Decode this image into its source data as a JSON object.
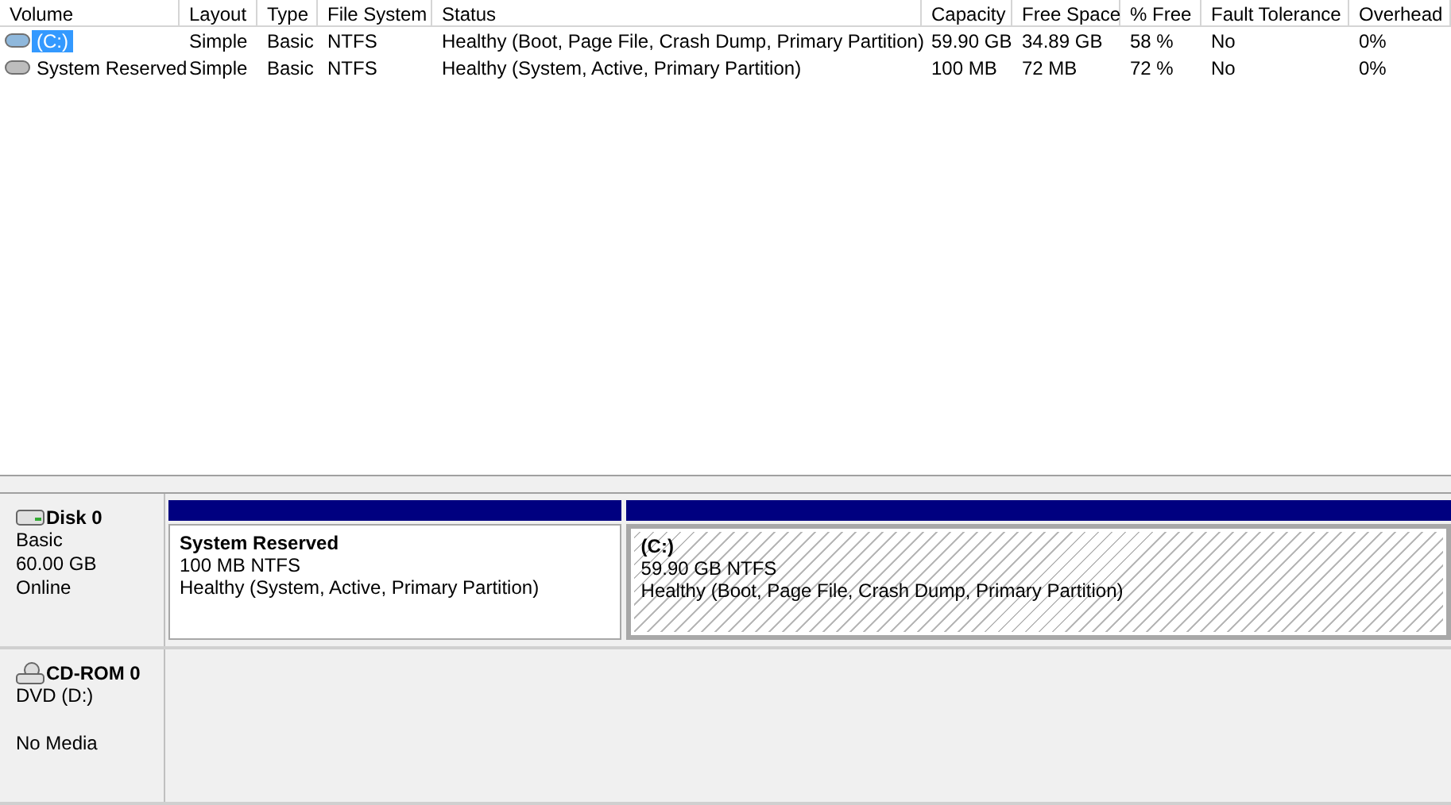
{
  "volumes": {
    "columns": [
      "Volume",
      "Layout",
      "Type",
      "File System",
      "Status",
      "Capacity",
      "Free Space",
      "% Free",
      "Fault Tolerance",
      "Overhead"
    ],
    "rows": [
      {
        "cells": [
          "(C:)",
          "Simple",
          "Basic",
          "NTFS",
          "Healthy (Boot, Page File, Crash Dump, Primary Partition)",
          "59.90 GB",
          "34.89 GB",
          "58 %",
          "No",
          "0%"
        ],
        "selected": true
      },
      {
        "cells": [
          "System Reserved",
          "Simple",
          "Basic",
          "NTFS",
          "Healthy (System, Active, Primary Partition)",
          "100 MB",
          "72 MB",
          "72 %",
          "No",
          "0%"
        ],
        "selected": false
      }
    ]
  },
  "disks": [
    {
      "name": "Disk 0",
      "kind": "disk",
      "lines": [
        "Basic",
        "60.00 GB",
        "Online"
      ],
      "partitions": [
        {
          "name": "System Reserved",
          "size": "100 MB NTFS",
          "status": "Healthy (System, Active, Primary Partition)",
          "selected": false
        },
        {
          "name": "(C:)",
          "size": "59.90 GB NTFS",
          "status": "Healthy (Boot, Page File, Crash Dump, Primary Partition)",
          "selected": true
        }
      ]
    },
    {
      "name": "CD-ROM 0",
      "kind": "cdrom",
      "lines": [
        "DVD (D:)",
        "No Media"
      ]
    }
  ]
}
